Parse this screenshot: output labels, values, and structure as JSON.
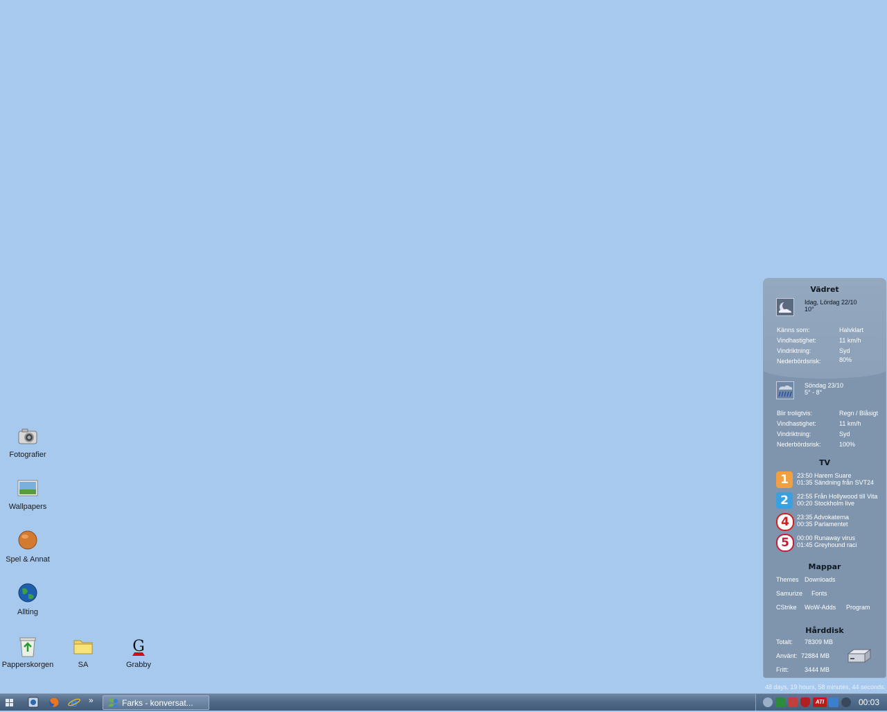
{
  "desktop": {
    "icons": [
      {
        "label": "Fotografier"
      },
      {
        "label": "Wallpapers"
      },
      {
        "label": "Spel & Annat"
      },
      {
        "label": "Allting"
      },
      {
        "label": "Papperskorgen"
      },
      {
        "label": "SA"
      },
      {
        "label": "Grabby"
      }
    ]
  },
  "widget": {
    "weather_title": "Vädret",
    "today": {
      "heading": "Idag, Lördag 22/10",
      "temp": "10°",
      "rows": [
        {
          "label": "Känns som:",
          "value": "Halvklart"
        },
        {
          "label": "Vindhastighet:",
          "value": "11 km/h"
        },
        {
          "label": "Vindriktning:",
          "value": "Syd"
        },
        {
          "label": "Nederbördsrisk:",
          "value": "80%"
        }
      ]
    },
    "tomorrow": {
      "heading": "Söndag 23/10",
      "temp": "5° - 8°",
      "rows": [
        {
          "label": "Blir troligtvis:",
          "value": "Regn / Blåsigt"
        },
        {
          "label": "Vindhastighet:",
          "value": "11 km/h"
        },
        {
          "label": "Vindriktning:",
          "value": "Syd"
        },
        {
          "label": "Nederbördsrisk:",
          "value": "100%"
        }
      ]
    },
    "tv_title": "TV",
    "tv": [
      {
        "channel": "1",
        "color": "#f0a040",
        "line1": "23:50 Harem Suare",
        "line2": "01:35 Sändning från SVT24"
      },
      {
        "channel": "2",
        "color": "#3aa0e0",
        "line1": "22:55 Från Hollywood till Vita",
        "line2": "00:20 Stockholm live"
      },
      {
        "channel": "4",
        "color": "#e02020",
        "line1": "23:35 Advokaterna",
        "line2": "00:35 Parlamentet"
      },
      {
        "channel": "5",
        "color": "#d02030",
        "line1": "00:00 Runaway virus",
        "line2": "01:45 Greyhound raci"
      }
    ],
    "folders_title": "Mappar",
    "folders": [
      "Themes",
      "Downloads",
      "Samurize",
      "Fonts",
      "CStrike",
      "WoW-Adds",
      "Program"
    ],
    "disk_title": "Hårddisk",
    "disk": [
      {
        "label": "Totalt:",
        "value": "78309 MB"
      },
      {
        "label": "Använt:",
        "value": "72884 MB"
      },
      {
        "label": "Fritt:",
        "value": "3444 MB"
      }
    ],
    "uptime": "48 days, 19 hours, 58 minutes, 44 seconds."
  },
  "taskbar": {
    "task_label": "Farks - konversat...",
    "chevron": "»",
    "clock": "00:03",
    "ati": "ATI"
  }
}
